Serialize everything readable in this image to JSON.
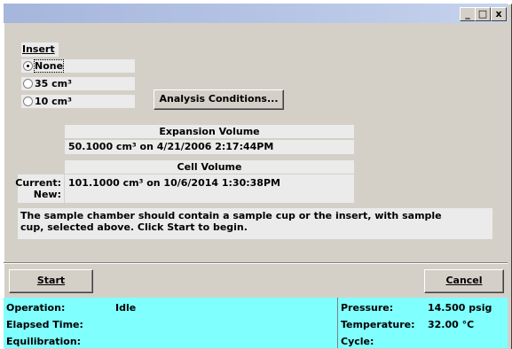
{
  "window": {
    "title": ""
  },
  "title_buttons": {
    "minimize": "_",
    "maximize": "□",
    "close": "x"
  },
  "insert": {
    "label": "Insert",
    "options": [
      "None",
      "35 cm³",
      "10 cm³"
    ],
    "selected": "None"
  },
  "analysis_button": "Analysis Conditions...",
  "expansion": {
    "header": "Expansion Volume",
    "value": "50.1000 cm³ on 4/21/2006 2:17:44PM"
  },
  "cell": {
    "header": "Cell Volume",
    "current_label": "Current:",
    "new_label": "New:",
    "current_value": "101.1000 cm³ on 10/6/2014 1:30:38PM",
    "new_value": ""
  },
  "message": "The sample chamber should contain a sample cup or the insert, with sample cup, selected above. Click Start to begin.",
  "buttons": {
    "start": "Start",
    "cancel": "Cancel"
  },
  "status": {
    "operation_label": "Operation:",
    "operation_value": "Idle",
    "elapsed_label": "Elapsed Time:",
    "elapsed_value": "",
    "equilibration_label": "Equilibration:",
    "equilibration_value": "",
    "pressure_label": "Pressure:",
    "pressure_value": "14.500 psig",
    "temperature_label": "Temperature:",
    "temperature_value": "32.00 °C",
    "cycle_label": "Cycle:",
    "cycle_value": ""
  },
  "colors": {
    "titlebar": "#b7c6e6",
    "face": "#d4d0c8",
    "field": "#ebebeb",
    "status": "#80ffff"
  }
}
